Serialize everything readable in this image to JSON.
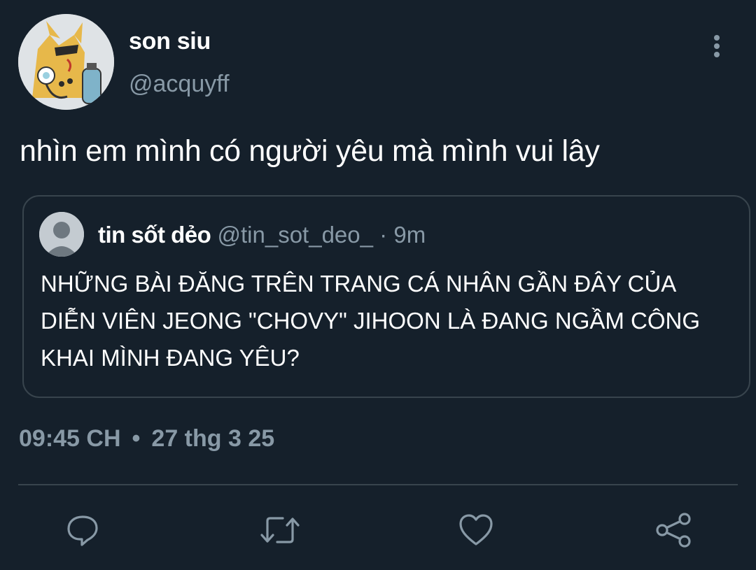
{
  "tweet": {
    "author_name": "son siu",
    "author_handle": "@acquyff",
    "text": "nhìn em mình có người yêu mà mình vui lây",
    "time": "09:45 CH",
    "separator": "•",
    "date": "27 thg 3 25"
  },
  "quote": {
    "author_name": "tin sốt dẻo",
    "author_handle": "@tin_sot_deo_",
    "dot": "·",
    "age": "9m",
    "text": "NHỮNG BÀI ĐĂNG TRÊN TRANG CÁ NHÂN GẦN ĐÂY CỦA DIỄN VIÊN JEONG \"CHOVY\" JIHOON LÀ ĐANG NGẦM CÔNG KHAI MÌNH ĐANG YÊU?"
  },
  "icons": {
    "more": "vertical-dots-icon",
    "reply": "comment-icon",
    "retweet": "retweet-icon",
    "like": "heart-icon",
    "share": "share-icon"
  },
  "colors": {
    "background": "#15202b",
    "secondary_text": "#8899a6",
    "border": "#38444d",
    "icon": "#8899a6"
  }
}
